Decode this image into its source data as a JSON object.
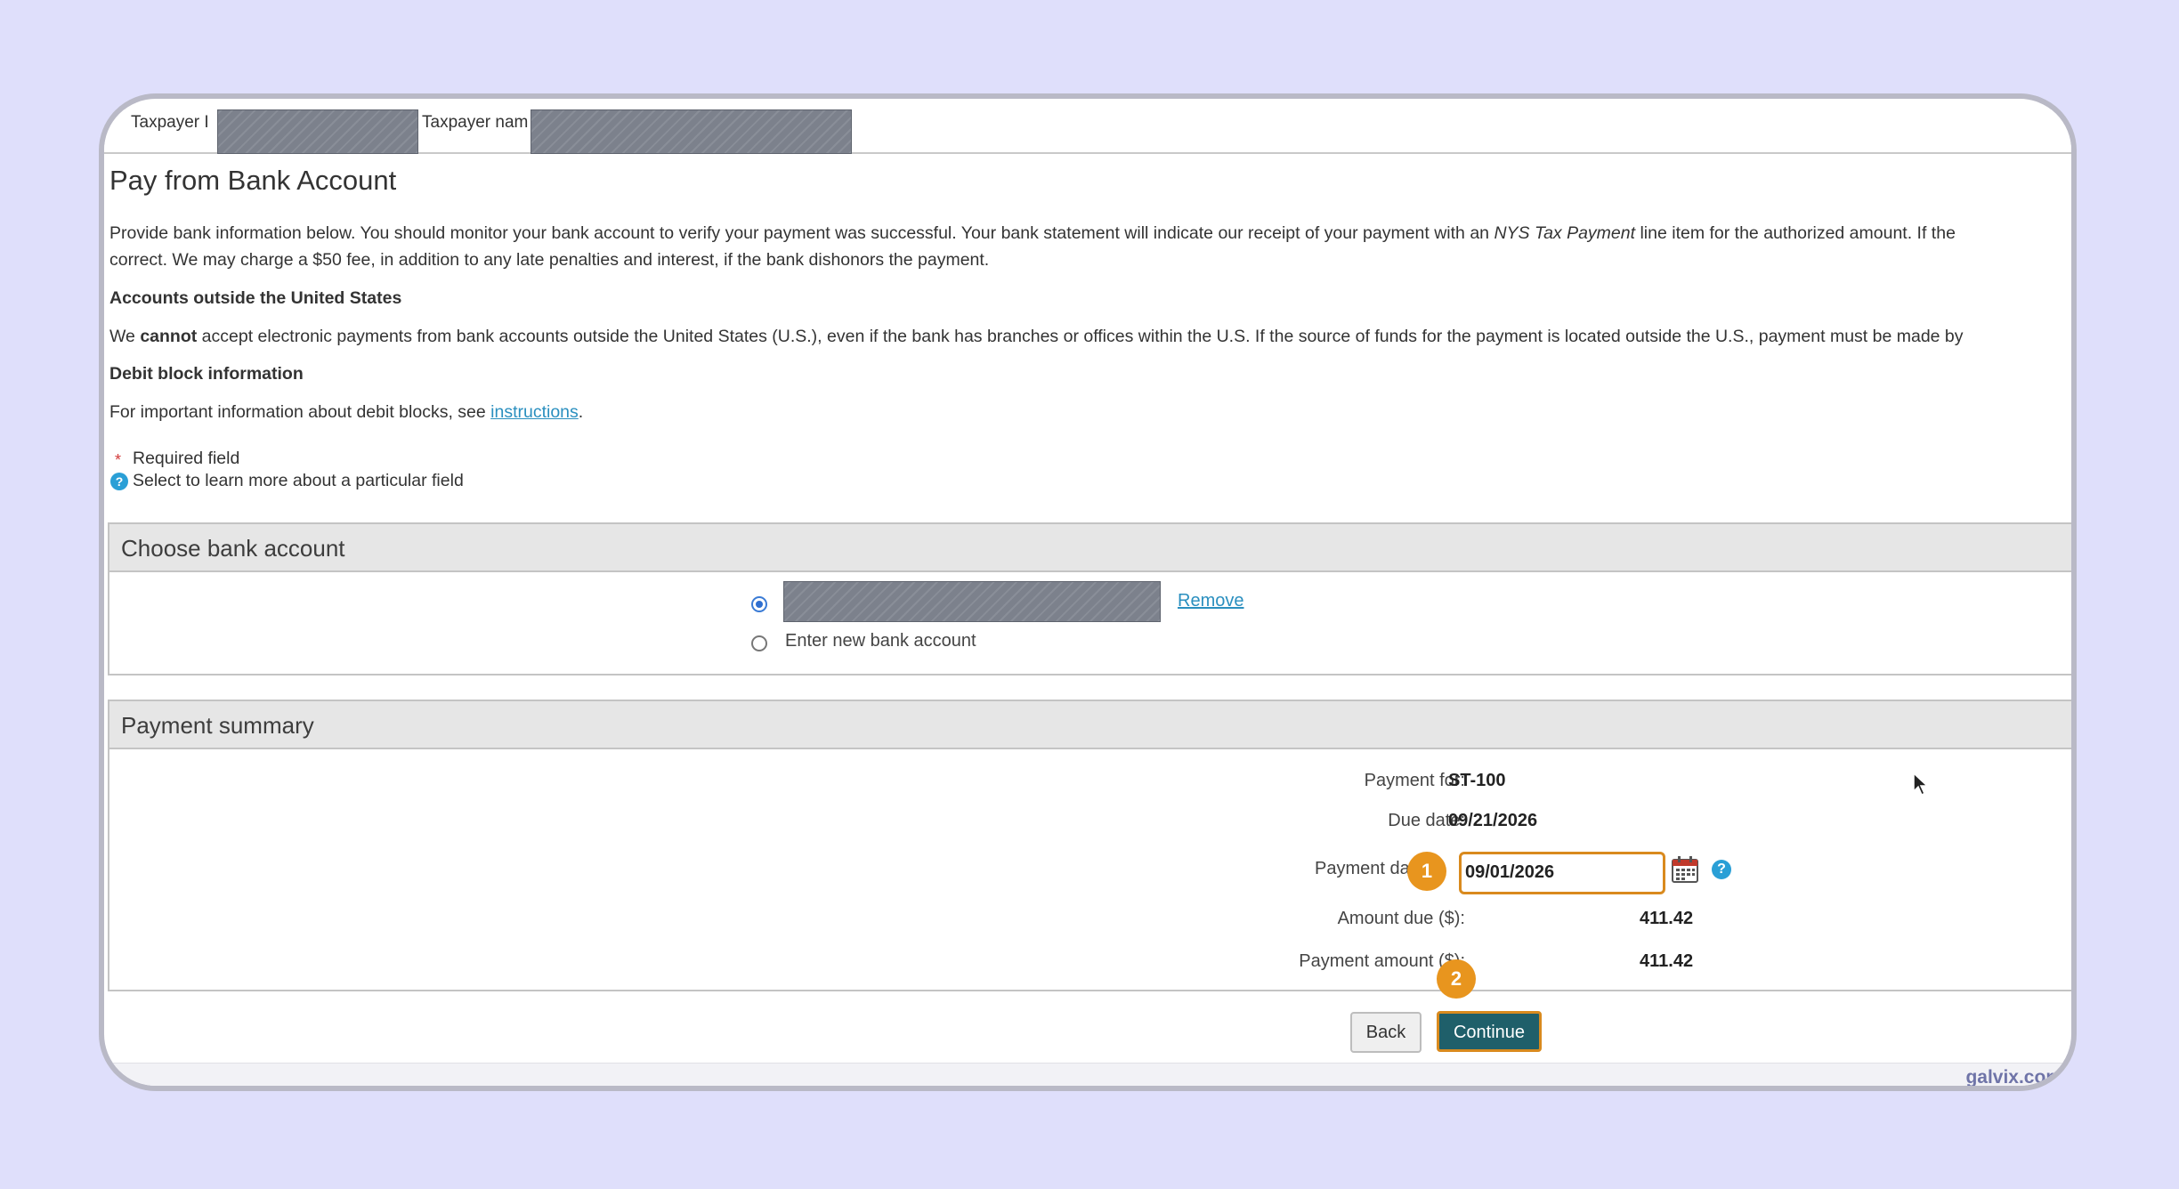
{
  "header": {
    "taxpayer_id_label": "Taxpayer I",
    "taxpayer_name_label": "Taxpayer nam"
  },
  "page": {
    "title": "Pay from Bank Account",
    "intro_line1": "Provide bank information below. You should monitor your bank account to verify your payment was successful. Your bank statement will indicate our receipt of your payment with an ",
    "intro_italic": "NYS Tax Payment",
    "intro_line1_end": " line item for the authorized amount. If the",
    "intro_line2": "correct. We may charge a $50 fee, in addition to any late penalties and interest, if the bank dishonors the payment.",
    "accounts_heading": "Accounts outside the United States",
    "accounts_we": "We ",
    "accounts_cannot": "cannot",
    "accounts_text": " accept electronic payments from bank accounts outside the United States (U.S.), even if the bank has branches or offices within the U.S. If the source of funds for the payment is located outside the U.S., payment must be made by",
    "debit_heading": "Debit block information",
    "debit_text": "For important information about debit blocks, see ",
    "debit_link": "instructions",
    "debit_period": ".",
    "required_star": "*",
    "required_text": "Required field",
    "help_glyph": "?",
    "help_text": "Select to learn more about a particular field"
  },
  "bank_section": {
    "title": "Choose bank account",
    "remove_link": "Remove",
    "new_account_label": "Enter new bank account"
  },
  "summary": {
    "title": "Payment summary",
    "payment_for_label": "Payment for:",
    "payment_for_value": "ST-100",
    "due_date_label": "Due date:",
    "due_date_value": "09/21/2026",
    "payment_date_label": "Payment da",
    "payment_date_value": "09/01/2026",
    "amount_due_label": "Amount due ($):",
    "amount_due_value": "411.42",
    "payment_amount_label": "Payment amount ($):",
    "payment_amount_value": "411.42"
  },
  "buttons": {
    "back": "Back",
    "continue": "Continue"
  },
  "annotations": {
    "step1": "1",
    "step2": "2"
  },
  "brand": "galvix.com",
  "colors": {
    "accent_orange": "#d98a1e",
    "continue_bg": "#1f5f6a",
    "link_blue": "#2a8fbf",
    "background": "#dfdffb"
  }
}
